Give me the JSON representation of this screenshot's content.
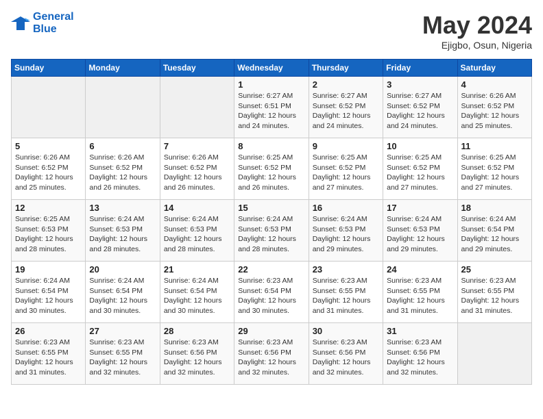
{
  "logo": {
    "line1": "General",
    "line2": "Blue"
  },
  "title": "May 2024",
  "location": "Ejigbo, Osun, Nigeria",
  "days_of_week": [
    "Sunday",
    "Monday",
    "Tuesday",
    "Wednesday",
    "Thursday",
    "Friday",
    "Saturday"
  ],
  "weeks": [
    [
      {
        "day": "",
        "sunrise": "",
        "sunset": "",
        "daylight": ""
      },
      {
        "day": "",
        "sunrise": "",
        "sunset": "",
        "daylight": ""
      },
      {
        "day": "",
        "sunrise": "",
        "sunset": "",
        "daylight": ""
      },
      {
        "day": "1",
        "sunrise": "6:27 AM",
        "sunset": "6:51 PM",
        "daylight": "12 hours and 24 minutes."
      },
      {
        "day": "2",
        "sunrise": "6:27 AM",
        "sunset": "6:52 PM",
        "daylight": "12 hours and 24 minutes."
      },
      {
        "day": "3",
        "sunrise": "6:27 AM",
        "sunset": "6:52 PM",
        "daylight": "12 hours and 24 minutes."
      },
      {
        "day": "4",
        "sunrise": "6:26 AM",
        "sunset": "6:52 PM",
        "daylight": "12 hours and 25 minutes."
      }
    ],
    [
      {
        "day": "5",
        "sunrise": "6:26 AM",
        "sunset": "6:52 PM",
        "daylight": "12 hours and 25 minutes."
      },
      {
        "day": "6",
        "sunrise": "6:26 AM",
        "sunset": "6:52 PM",
        "daylight": "12 hours and 26 minutes."
      },
      {
        "day": "7",
        "sunrise": "6:26 AM",
        "sunset": "6:52 PM",
        "daylight": "12 hours and 26 minutes."
      },
      {
        "day": "8",
        "sunrise": "6:25 AM",
        "sunset": "6:52 PM",
        "daylight": "12 hours and 26 minutes."
      },
      {
        "day": "9",
        "sunrise": "6:25 AM",
        "sunset": "6:52 PM",
        "daylight": "12 hours and 27 minutes."
      },
      {
        "day": "10",
        "sunrise": "6:25 AM",
        "sunset": "6:52 PM",
        "daylight": "12 hours and 27 minutes."
      },
      {
        "day": "11",
        "sunrise": "6:25 AM",
        "sunset": "6:52 PM",
        "daylight": "12 hours and 27 minutes."
      }
    ],
    [
      {
        "day": "12",
        "sunrise": "6:25 AM",
        "sunset": "6:53 PM",
        "daylight": "12 hours and 28 minutes."
      },
      {
        "day": "13",
        "sunrise": "6:24 AM",
        "sunset": "6:53 PM",
        "daylight": "12 hours and 28 minutes."
      },
      {
        "day": "14",
        "sunrise": "6:24 AM",
        "sunset": "6:53 PM",
        "daylight": "12 hours and 28 minutes."
      },
      {
        "day": "15",
        "sunrise": "6:24 AM",
        "sunset": "6:53 PM",
        "daylight": "12 hours and 28 minutes."
      },
      {
        "day": "16",
        "sunrise": "6:24 AM",
        "sunset": "6:53 PM",
        "daylight": "12 hours and 29 minutes."
      },
      {
        "day": "17",
        "sunrise": "6:24 AM",
        "sunset": "6:53 PM",
        "daylight": "12 hours and 29 minutes."
      },
      {
        "day": "18",
        "sunrise": "6:24 AM",
        "sunset": "6:54 PM",
        "daylight": "12 hours and 29 minutes."
      }
    ],
    [
      {
        "day": "19",
        "sunrise": "6:24 AM",
        "sunset": "6:54 PM",
        "daylight": "12 hours and 30 minutes."
      },
      {
        "day": "20",
        "sunrise": "6:24 AM",
        "sunset": "6:54 PM",
        "daylight": "12 hours and 30 minutes."
      },
      {
        "day": "21",
        "sunrise": "6:24 AM",
        "sunset": "6:54 PM",
        "daylight": "12 hours and 30 minutes."
      },
      {
        "day": "22",
        "sunrise": "6:23 AM",
        "sunset": "6:54 PM",
        "daylight": "12 hours and 30 minutes."
      },
      {
        "day": "23",
        "sunrise": "6:23 AM",
        "sunset": "6:55 PM",
        "daylight": "12 hours and 31 minutes."
      },
      {
        "day": "24",
        "sunrise": "6:23 AM",
        "sunset": "6:55 PM",
        "daylight": "12 hours and 31 minutes."
      },
      {
        "day": "25",
        "sunrise": "6:23 AM",
        "sunset": "6:55 PM",
        "daylight": "12 hours and 31 minutes."
      }
    ],
    [
      {
        "day": "26",
        "sunrise": "6:23 AM",
        "sunset": "6:55 PM",
        "daylight": "12 hours and 31 minutes."
      },
      {
        "day": "27",
        "sunrise": "6:23 AM",
        "sunset": "6:55 PM",
        "daylight": "12 hours and 32 minutes."
      },
      {
        "day": "28",
        "sunrise": "6:23 AM",
        "sunset": "6:56 PM",
        "daylight": "12 hours and 32 minutes."
      },
      {
        "day": "29",
        "sunrise": "6:23 AM",
        "sunset": "6:56 PM",
        "daylight": "12 hours and 32 minutes."
      },
      {
        "day": "30",
        "sunrise": "6:23 AM",
        "sunset": "6:56 PM",
        "daylight": "12 hours and 32 minutes."
      },
      {
        "day": "31",
        "sunrise": "6:23 AM",
        "sunset": "6:56 PM",
        "daylight": "12 hours and 32 minutes."
      },
      {
        "day": "",
        "sunrise": "",
        "sunset": "",
        "daylight": ""
      }
    ]
  ]
}
